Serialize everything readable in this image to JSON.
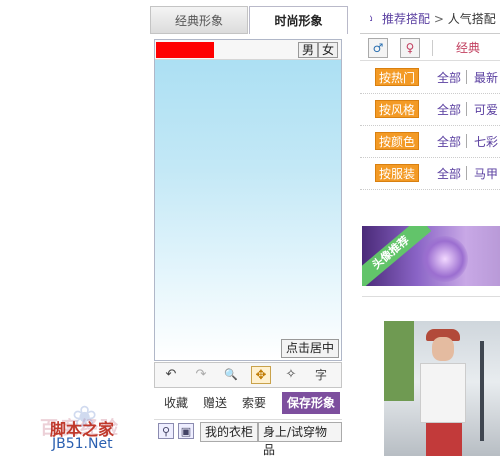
{
  "left_panel": {
    "tabs": [
      {
        "label": "经典形象"
      },
      {
        "label": "时尚形象"
      }
    ],
    "gender": {
      "male": "男",
      "female": "女"
    },
    "center_button": "点击居中",
    "toolbar": {
      "undo_icon": "↶",
      "redo_icon": "↷",
      "zoom_icon": "🔍",
      "move_icon": "✥",
      "wand_icon": "✧",
      "text_tool": "字"
    },
    "actions": {
      "collect": "收藏",
      "gift": "赠送",
      "request": "索要",
      "save": "保存形象"
    },
    "bottom": {
      "wardrobe": "我的衣柜",
      "try_on": "身上/试穿物品"
    }
  },
  "right_panel": {
    "breadcrumb": {
      "link": "推荐搭配",
      "separator": ">",
      "current": "人气搭配"
    },
    "filter": {
      "label": "经典"
    },
    "rows": [
      {
        "tag": "按热门",
        "all": "全部",
        "option": "最新"
      },
      {
        "tag": "按风格",
        "all": "全部",
        "option": "可爱"
      },
      {
        "tag": "按颜色",
        "all": "全部",
        "option": "七彩"
      },
      {
        "tag": "按服装",
        "all": "全部",
        "option": "马甲"
      }
    ],
    "banner": {
      "ribbon": "头像推荐"
    }
  },
  "watermark": {
    "line1": "脚本之家",
    "faint": "百度经验",
    "line2": "JB51.Net"
  }
}
